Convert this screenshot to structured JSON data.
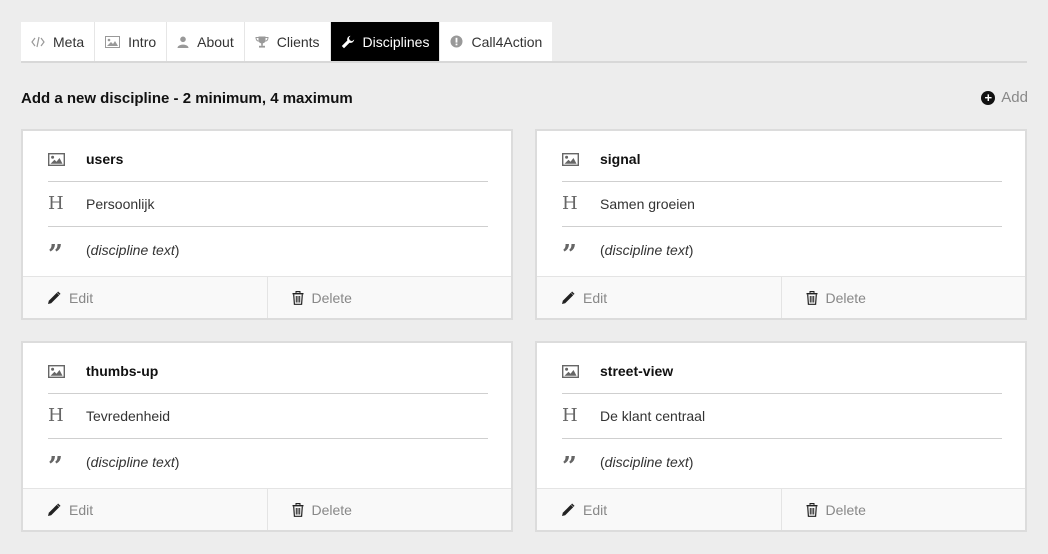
{
  "tabs": [
    {
      "label": "Meta",
      "icon": "code-icon",
      "active": false
    },
    {
      "label": "Intro",
      "icon": "image-icon",
      "active": false
    },
    {
      "label": "About",
      "icon": "user-icon",
      "active": false
    },
    {
      "label": "Clients",
      "icon": "trophy-icon",
      "active": false
    },
    {
      "label": "Disciplines",
      "icon": "wrench-icon",
      "active": true
    },
    {
      "label": "Call4Action",
      "icon": "exclamation-circle-icon",
      "active": false
    }
  ],
  "heading": "Add a new discipline - 2 minimum, 4 maximum",
  "add_label": "Add",
  "cards": [
    {
      "icon_name": "users",
      "title": "Persoonlijk",
      "text_placeholder": "discipline text",
      "edit_label": "Edit",
      "delete_label": "Delete"
    },
    {
      "icon_name": "signal",
      "title": "Samen groeien",
      "text_placeholder": "discipline text",
      "edit_label": "Edit",
      "delete_label": "Delete"
    },
    {
      "icon_name": "thumbs-up",
      "title": "Tevredenheid",
      "text_placeholder": "discipline text",
      "edit_label": "Edit",
      "delete_label": "Delete"
    },
    {
      "icon_name": "street-view",
      "title": "De klant centraal",
      "text_placeholder": "discipline text",
      "edit_label": "Edit",
      "delete_label": "Delete"
    }
  ]
}
